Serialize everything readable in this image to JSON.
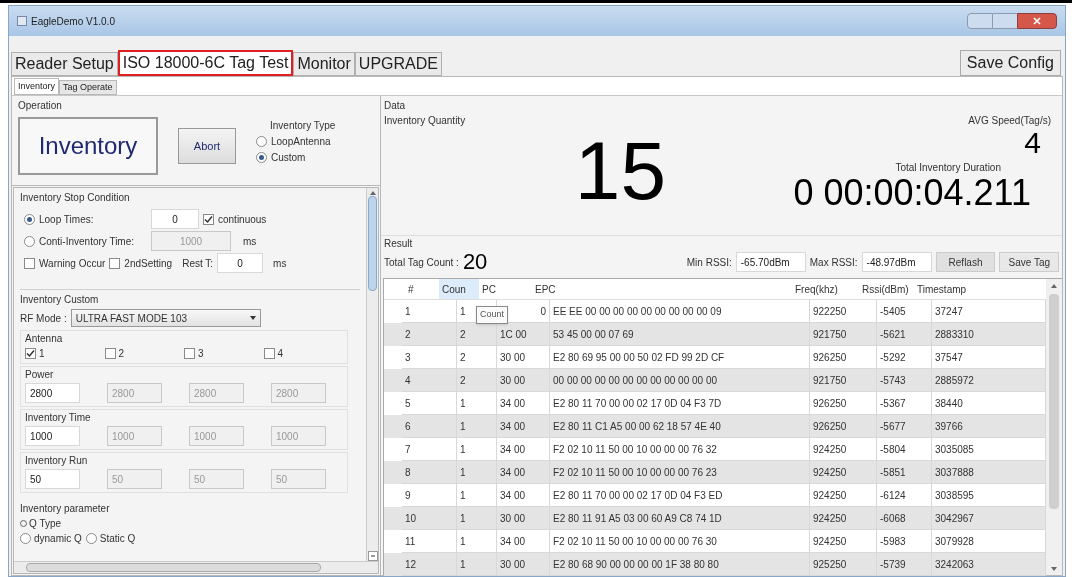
{
  "window": {
    "title": "EagleDemo V1.0.0"
  },
  "tabs": [
    {
      "label": "Reader Setup",
      "selected": false
    },
    {
      "label": "ISO 18000-6C Tag Test",
      "selected": true
    },
    {
      "label": "Monitor",
      "selected": false
    },
    {
      "label": "UPGRADE",
      "selected": false
    }
  ],
  "save_config": "Save Config",
  "subtabs": [
    {
      "label": "Inventory",
      "selected": true
    },
    {
      "label": "Tag Operate",
      "selected": false
    }
  ],
  "operation": {
    "title": "Operation",
    "inventory_button": "Inventory",
    "abort_button": "Abort",
    "inventory_type": {
      "title": "Inventory Type",
      "options": [
        {
          "label": "LoopAntenna",
          "selected": false
        },
        {
          "label": "Custom",
          "selected": true
        }
      ]
    }
  },
  "stop_condition": {
    "title": "Inventory Stop Condition",
    "loop_times": {
      "label": "Loop Times:",
      "selected": true,
      "value": "0"
    },
    "continuous": {
      "label": "continuous",
      "checked": true
    },
    "cont_time": {
      "label": "Conti-Inventory Time:",
      "selected": false,
      "value": "1000",
      "unit": "ms"
    },
    "warning": {
      "label": "Warning Occur",
      "checked": false
    },
    "second": {
      "label": "2ndSetting",
      "checked": false
    },
    "rest": {
      "label": "Rest T:",
      "value": "0",
      "unit": "ms"
    }
  },
  "custom": {
    "title": "Inventory Custom",
    "rf_mode_label": "RF Mode :",
    "rf_mode": "ULTRA FAST MODE 103",
    "antenna_title": "Antenna",
    "antennas": [
      {
        "label": "1",
        "checked": true
      },
      {
        "label": "2",
        "checked": false
      },
      {
        "label": "3",
        "checked": false
      },
      {
        "label": "4",
        "checked": false
      }
    ],
    "groups": [
      {
        "title": "Power",
        "values": [
          {
            "value": "2800",
            "disabled": false
          },
          {
            "value": "2800",
            "disabled": true
          },
          {
            "value": "2800",
            "disabled": true
          },
          {
            "value": "2800",
            "disabled": true
          }
        ]
      },
      {
        "title": "Inventory Time",
        "values": [
          {
            "value": "1000",
            "disabled": false
          },
          {
            "value": "1000",
            "disabled": true
          },
          {
            "value": "1000",
            "disabled": true
          },
          {
            "value": "1000",
            "disabled": true
          }
        ]
      },
      {
        "title": "Inventory Run",
        "values": [
          {
            "value": "50",
            "disabled": false
          },
          {
            "value": "50",
            "disabled": true
          },
          {
            "value": "50",
            "disabled": true
          },
          {
            "value": "50",
            "disabled": true
          }
        ]
      }
    ]
  },
  "parameter": {
    "title": "Inventory parameter",
    "q_type": "Q Type",
    "options": [
      {
        "label": "dynamic Q",
        "selected": false
      },
      {
        "label": "Static Q",
        "selected": false
      }
    ]
  },
  "data": {
    "title": "Data",
    "quantity_label": "Inventory Quantity",
    "quantity": "15",
    "speed_label": "AVG Speed(Tag/s)",
    "speed": "4",
    "duration_label": "Total Inventory Duration",
    "duration": "0 00:00:04.211"
  },
  "result": {
    "title": "Result",
    "total_label": "Total Tag Count :",
    "total": "20",
    "min_rssi_label": "Min RSSI:",
    "min_rssi": "-65.70dBm",
    "max_rssi_label": "Max RSSI:",
    "max_rssi": "-48.97dBm",
    "refresh": "Reflash",
    "save_tag": "Save Tag"
  },
  "table": {
    "columns": [
      "#",
      "Coun",
      "PC",
      "EPC",
      "Freq(khz)",
      "Rssi(dBm)",
      "Timestamp"
    ],
    "tooltip": "Count",
    "rows": [
      [
        "1",
        "1",
        "0",
        "EE EE 00 00 00 00 00 00 00 00 00 09",
        "922250",
        "-5405",
        "37247"
      ],
      [
        "2",
        "2",
        "1C 00",
        "53 45 00 00 07 69",
        "921750",
        "-5621",
        "2883310"
      ],
      [
        "3",
        "2",
        "30 00",
        "E2 80 69 95 00 00 50 02 FD 99 2D CF",
        "926250",
        "-5292",
        "37547"
      ],
      [
        "4",
        "2",
        "30 00",
        "00 00 00 00 00 00 00 00 00 00 00 00",
        "921750",
        "-5743",
        "2885972"
      ],
      [
        "5",
        "1",
        "34 00",
        "E2 80 11 70 00 00 02 17 0D 04 F3 7D",
        "926250",
        "-5367",
        "38440"
      ],
      [
        "6",
        "1",
        "34 00",
        "E2 80 11 C1 A5 00 00 62 18 57 4E 40",
        "926250",
        "-5677",
        "39766"
      ],
      [
        "7",
        "1",
        "34 00",
        "F2 02 10 11 50 00 10 00 00 00 76 32",
        "924250",
        "-5804",
        "3035085"
      ],
      [
        "8",
        "1",
        "34 00",
        "F2 02 10 11 50 00 10 00 00 00 76 23",
        "924250",
        "-5851",
        "3037888"
      ],
      [
        "9",
        "1",
        "34 00",
        "E2 80 11 70 00 00 02 17 0D 04 F3 ED",
        "924250",
        "-6124",
        "3038595"
      ],
      [
        "10",
        "1",
        "30 00",
        "E2 80 11 91 A5 03 00 60 A9 C8 74 1D",
        "924250",
        "-6068",
        "3042967"
      ],
      [
        "11",
        "1",
        "34 00",
        "F2 02 10 11 50 00 10 00 00 00 76 30",
        "924250",
        "-5983",
        "3079928"
      ],
      [
        "12",
        "1",
        "30 00",
        "E2 80 68 90 00 00 00 00 1F 38 80 80",
        "925250",
        "-5739",
        "3242063"
      ]
    ]
  }
}
